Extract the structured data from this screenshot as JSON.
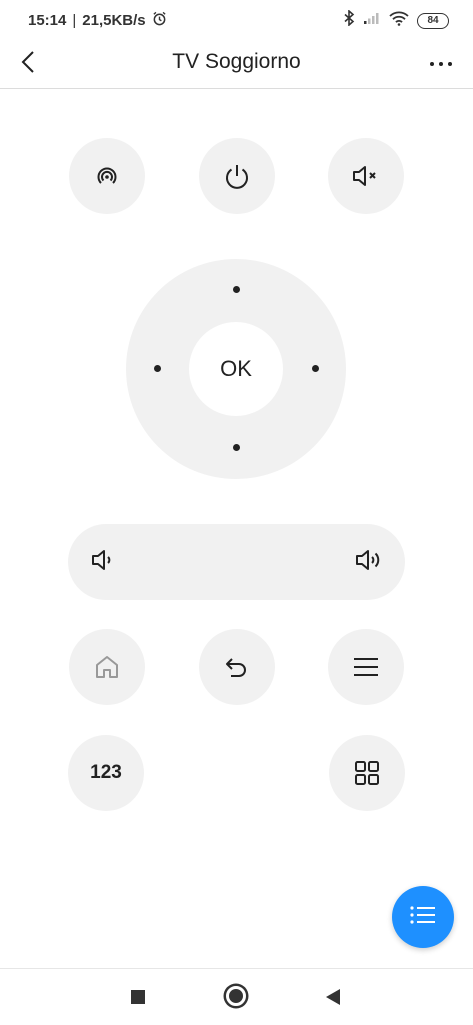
{
  "status_bar": {
    "time": "15:14",
    "network_speed": "21,5KB/s",
    "battery": "84",
    "icons": [
      "alarm-icon",
      "bluetooth-icon",
      "signal-icon",
      "wifi-icon",
      "battery-icon"
    ]
  },
  "header": {
    "title": "TV Soggiorno",
    "back_icon": "chevron-left-icon",
    "more_icon": "more-horizontal-icon"
  },
  "remote": {
    "top_row": [
      "source-icon",
      "power-icon",
      "mute-icon"
    ],
    "dpad": {
      "ok_label": "OK"
    },
    "volume": [
      "volume-down-icon",
      "volume-up-icon"
    ],
    "middle_row": [
      "home-icon",
      "back-icon",
      "menu-icon"
    ],
    "bottom_row": {
      "numbers_label": "123",
      "apps_icon": "apps-grid-icon"
    }
  },
  "fab": {
    "icon": "list-icon",
    "color": "#1e90ff"
  },
  "nav_bar": [
    "recents-icon",
    "home-icon",
    "back-icon"
  ],
  "colors": {
    "button_bg": "#f1f1f1",
    "accent": "#1e90ff",
    "text": "#222222"
  }
}
